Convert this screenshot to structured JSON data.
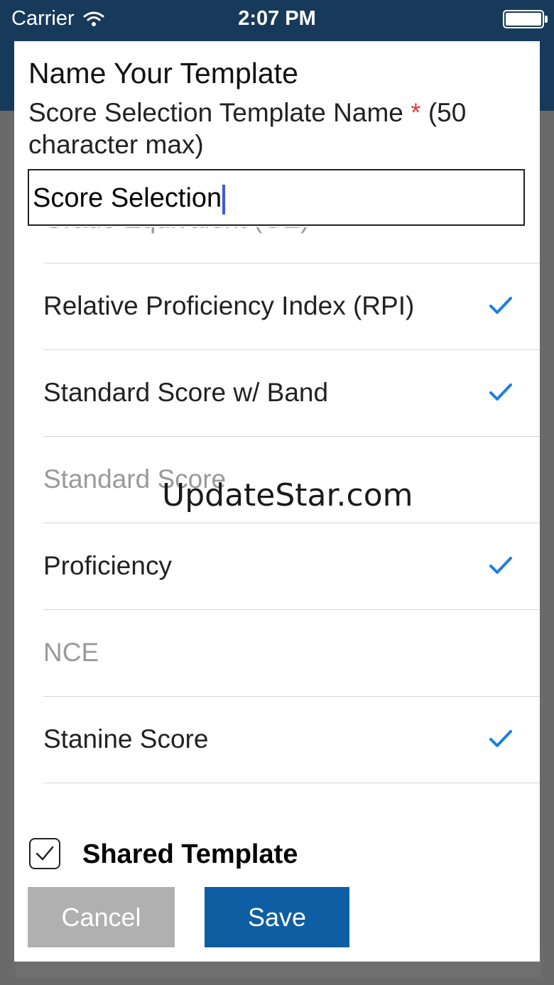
{
  "status_bar": {
    "carrier": "Carrier",
    "time": "2:07 PM"
  },
  "dialog": {
    "title": "Name Your Template",
    "field_label": "Score Selection Template Name",
    "required_mark": "*",
    "field_hint": "(50 character max)",
    "name_value": "Score Selection"
  },
  "score_list": [
    {
      "label": "Grade Equivalent (GE)",
      "checked": false
    },
    {
      "label": "Relative Proficiency Index (RPI)",
      "checked": true
    },
    {
      "label": "Standard Score w/ Band",
      "checked": true
    },
    {
      "label": "Standard Score",
      "checked": false
    },
    {
      "label": "Proficiency",
      "checked": true
    },
    {
      "label": "NCE",
      "checked": false
    },
    {
      "label": "Stanine Score",
      "checked": true
    }
  ],
  "shared_template": {
    "label": "Shared Template",
    "checked": true
  },
  "buttons": {
    "cancel": "Cancel",
    "save": "Save"
  },
  "watermark": "UpdateStar.com",
  "colors": {
    "header_bg": "#173a5a",
    "check_color": "#1a7ee6",
    "save_bg": "#0d5ea3",
    "cancel_bg": "#b0b0b0",
    "required_color": "#e53935"
  },
  "icons": {
    "wifi": "wifi-icon",
    "battery": "battery-icon",
    "check": "checkmark-icon"
  }
}
